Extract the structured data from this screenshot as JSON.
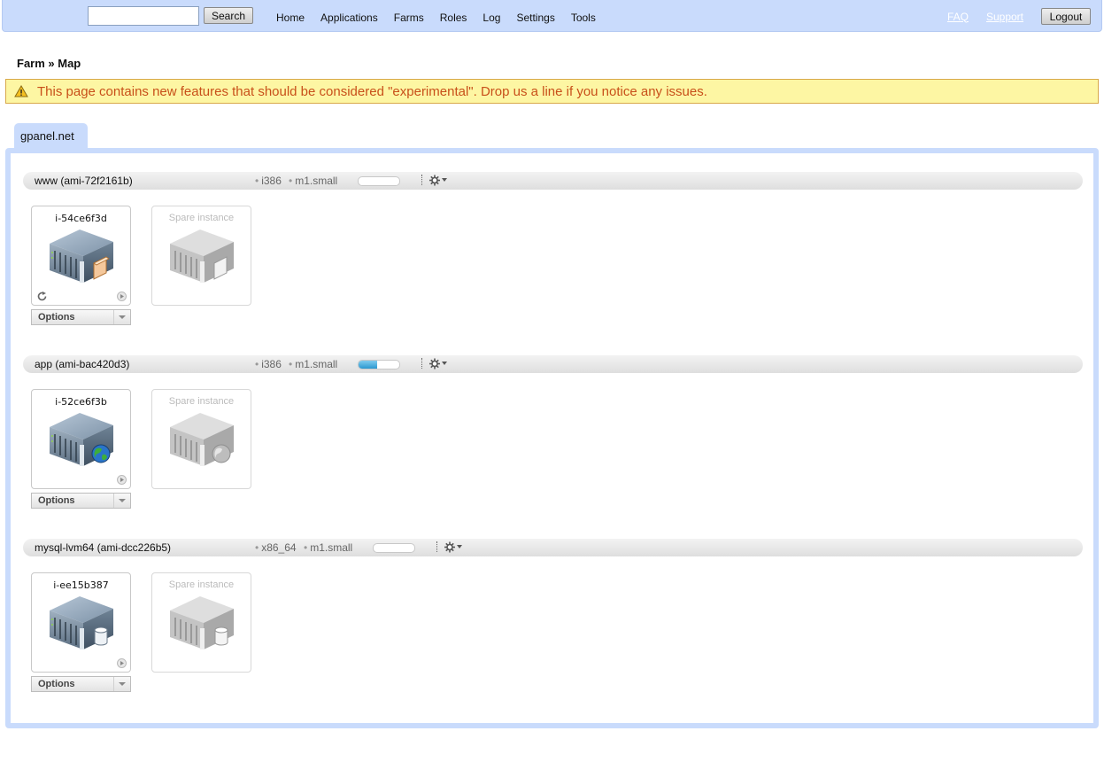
{
  "header": {
    "search_placeholder": "",
    "search_button": "Search",
    "nav": [
      "Home",
      "Applications",
      "Farms",
      "Roles",
      "Log",
      "Settings",
      "Tools"
    ],
    "links": {
      "faq": "FAQ",
      "support": "Support"
    },
    "logout": "Logout"
  },
  "breadcrumb": "Farm » Map",
  "warning": "This page contains new features that should be considered \"experimental\". Drop us a line if you notice any issues.",
  "farm_tab": "gpanel.net",
  "roles": [
    {
      "name": "www (ami-72f2161b)",
      "arch": "i386",
      "size": "m1.small",
      "progress": 0,
      "instance_id": "i-54ce6f3d",
      "instance_badge": "folder-icon",
      "spare_label": "Spare instance",
      "options_label": "Options"
    },
    {
      "name": "app (ami-bac420d3)",
      "arch": "i386",
      "size": "m1.small",
      "progress": 0.45,
      "instance_id": "i-52ce6f3b",
      "instance_badge": "globe-icon",
      "spare_label": "Spare instance",
      "options_label": "Options"
    },
    {
      "name": "mysql-lvm64 (ami-dcc226b5)",
      "arch": "x86_64",
      "size": "m1.small",
      "progress": 0,
      "instance_id": "i-ee15b387",
      "instance_badge": "database-icon",
      "spare_label": "Spare instance",
      "options_label": "Options"
    }
  ],
  "colors": {
    "topbar": "#c9dbfc",
    "warning_bg": "#fdf6a3",
    "warning_text": "#c8501a",
    "progress": "#2b98d0"
  }
}
